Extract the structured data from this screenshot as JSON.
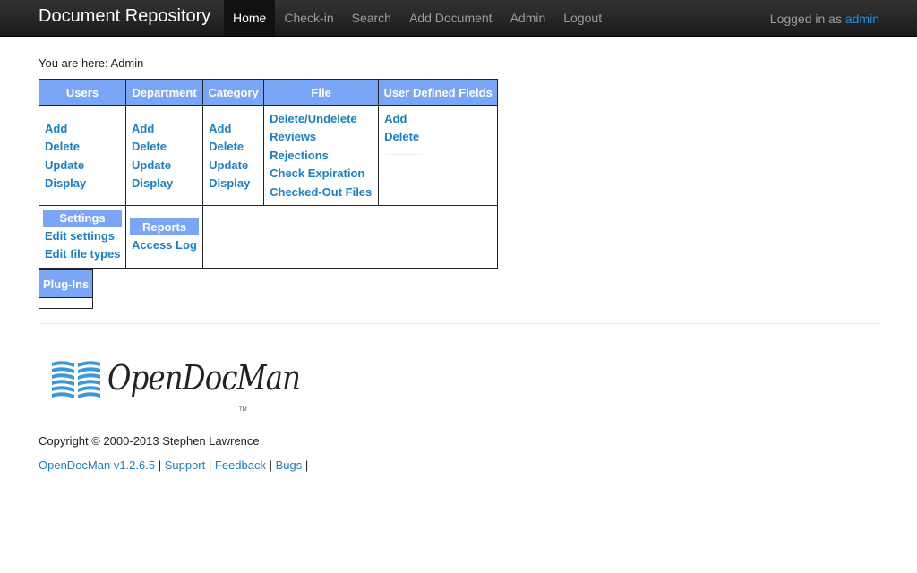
{
  "navbar": {
    "brand": "Document Repository",
    "items": [
      {
        "label": "Home",
        "active": true
      },
      {
        "label": "Check-in"
      },
      {
        "label": "Search"
      },
      {
        "label": "Add Document"
      },
      {
        "label": "Admin"
      },
      {
        "label": "Logout"
      }
    ],
    "logged_in_prefix": "Logged in as",
    "username": "admin"
  },
  "breadcrumb": "You are here: Admin",
  "admin_table": {
    "headers": [
      "Users",
      "Department",
      "Category",
      "File",
      "User Defined Fields"
    ],
    "users_links": [
      "Add",
      "Delete",
      "Update",
      "Display"
    ],
    "department_links": [
      "Add",
      "Delete",
      "Update",
      "Display"
    ],
    "category_links": [
      "Add",
      "Delete",
      "Update",
      "Display"
    ],
    "file_links": [
      "Delete/Undelete",
      "Reviews",
      "Rejections",
      "Check Expiration",
      "Checked-Out Files"
    ],
    "udf_links": [
      "Add",
      "Delete"
    ],
    "settings": {
      "header": "Settings",
      "links": [
        "Edit settings",
        "Edit file types"
      ]
    },
    "reports": {
      "header": "Reports",
      "links": [
        "Access Log"
      ]
    }
  },
  "plugins": {
    "header": "Plug-Ins"
  },
  "logo": {
    "text": "OpenDocMan",
    "tm": "TM"
  },
  "footer": {
    "copyright": "Copyright © 2000-2013 Stephen Lawrence",
    "version_link": "OpenDocMan v1.2.6.5",
    "support_link": "Support",
    "feedback_link": "Feedback",
    "bugs_link": "Bugs",
    "separator": "|"
  },
  "colors": {
    "navbar_bg": "#222222",
    "header_blue": "#7aa6f8",
    "link_blue": "#1a7fc4",
    "logo_blue": "#3a9ad9"
  }
}
